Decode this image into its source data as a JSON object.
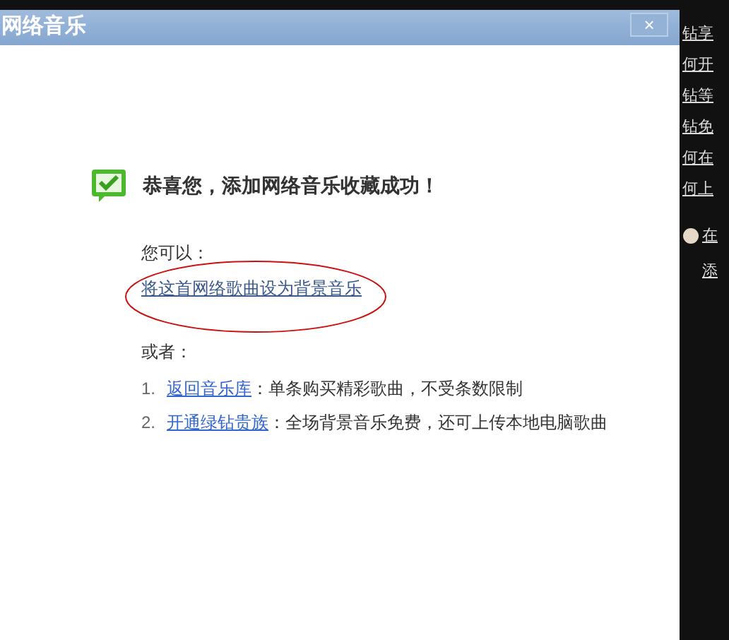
{
  "dialog": {
    "title": "网络音乐",
    "close": "×",
    "heading": "恭喜您，添加网络音乐收藏成功！",
    "intro": "您可以：",
    "primary_link": "将这首网络歌曲设为背景音乐",
    "alt_label": "或者：",
    "options": [
      {
        "number": "1.",
        "link": "返回音乐库",
        "text": "：单条购买精彩歌曲，不受条数限制"
      },
      {
        "number": "2.",
        "link": "开通绿钻贵族",
        "text": "：全场背景音乐免费，还可上传本地电脑歌曲"
      }
    ]
  },
  "background_links": [
    "钻享",
    "何开",
    "钻等",
    "钻免",
    "何在",
    "何上"
  ],
  "background_items": [
    {
      "kind": "icon",
      "text": "在"
    },
    {
      "kind": "plain",
      "text": "添"
    }
  ]
}
